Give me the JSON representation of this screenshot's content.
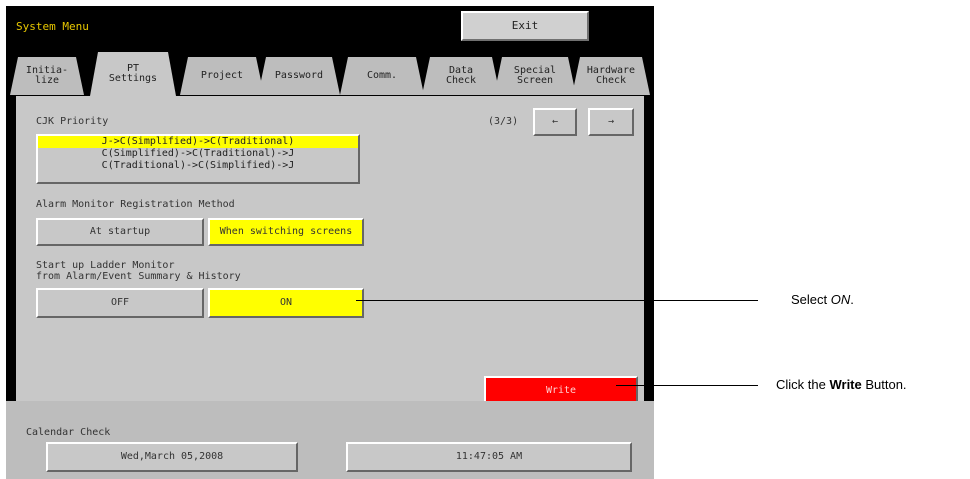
{
  "window": {
    "title": "System Menu",
    "exit_label": "Exit"
  },
  "tabs": [
    {
      "label": "Initia-\nlize",
      "active": false
    },
    {
      "label": "PT\nSettings",
      "active": true
    },
    {
      "label": "Project",
      "active": false
    },
    {
      "label": "Password",
      "active": false
    },
    {
      "label": "Comm.",
      "active": false
    },
    {
      "label": "Data\nCheck",
      "active": false
    },
    {
      "label": "Special\nScreen",
      "active": false
    },
    {
      "label": "Hardware\nCheck",
      "active": false
    }
  ],
  "page": {
    "indicator": "(3/3)",
    "prev_label": "←",
    "next_label": "→"
  },
  "cjk": {
    "label": "CJK Priority",
    "options": [
      "J->C(Simplified)->C(Traditional)",
      "C(Simplified)->C(Traditional)->J",
      "C(Traditional)->C(Simplified)->J"
    ],
    "selected_index": 0
  },
  "alarm": {
    "label": "Alarm Monitor Registration Method",
    "option_startup": "At startup",
    "option_switch": "When switching screens",
    "selected": "When switching screens"
  },
  "ladder": {
    "label": "Start up Ladder Monitor\nfrom Alarm/Event Summary & History",
    "option_off": "OFF",
    "option_on": "ON",
    "selected": "ON"
  },
  "write_label": "Write",
  "calendar": {
    "label": "Calendar Check",
    "date": "Wed,March 05,2008",
    "time": "11:47:05 AM"
  },
  "annotations": {
    "select_on_prefix": "Select ",
    "select_on_em": "ON",
    "select_on_suffix": ".",
    "write_prefix": "Click the ",
    "write_bold": "Write",
    "write_suffix": " Button."
  },
  "colors": {
    "selected": "#ffff00",
    "write": "#ff0000",
    "title_text": "#e8c800"
  }
}
